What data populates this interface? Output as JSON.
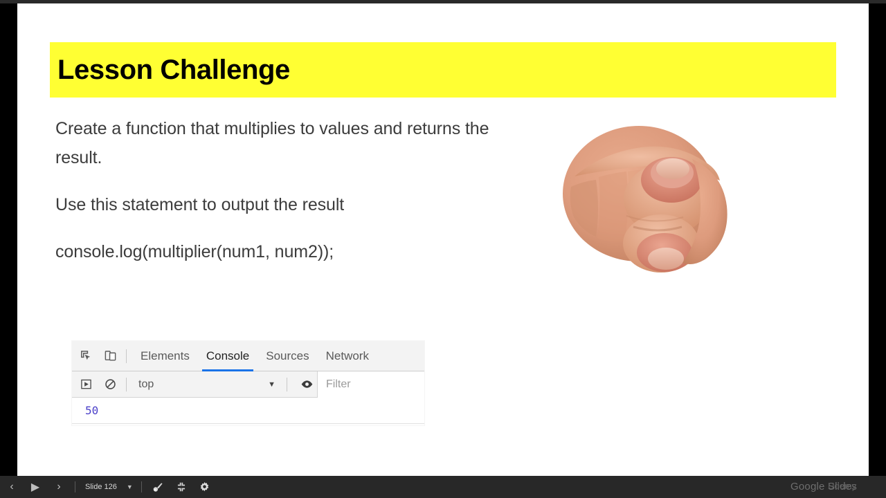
{
  "slide": {
    "title": "Lesson Challenge",
    "title_highlight_color": "#ffff33",
    "paragraphs": [
      "Create a function that multiplies to values and returns the result.",
      "Use this statement to output the result",
      "console.log(multiplier(num1, num2));"
    ],
    "illustration": "pointing-hand-image"
  },
  "devtools": {
    "icons": {
      "inspect": "inspect-element-icon",
      "device": "device-toolbar-icon",
      "execute": "execute-script-icon",
      "clear": "clear-console-icon",
      "eye": "live-expression-eye-icon"
    },
    "tabs": [
      {
        "label": "Elements",
        "active": false
      },
      {
        "label": "Console",
        "active": true
      },
      {
        "label": "Sources",
        "active": false
      },
      {
        "label": "Network",
        "active": false
      }
    ],
    "active_tab_underline_color": "#1a73e8",
    "context_selector": "top",
    "filter_placeholder": "Filter",
    "output": "50",
    "output_color": "#4b40c9"
  },
  "toolbar": {
    "prev_label": "‹",
    "play_label": "▶",
    "next_label": "›",
    "slide_label": "Slide 126",
    "caret_label": "▼",
    "laser_icon": "laser-pointer-icon",
    "fullscreen_icon": "exit-fullscreen-icon",
    "settings_icon": "gear-icon",
    "watermark_primary": "Google Slides",
    "watermark_secondary": "Udemy"
  }
}
